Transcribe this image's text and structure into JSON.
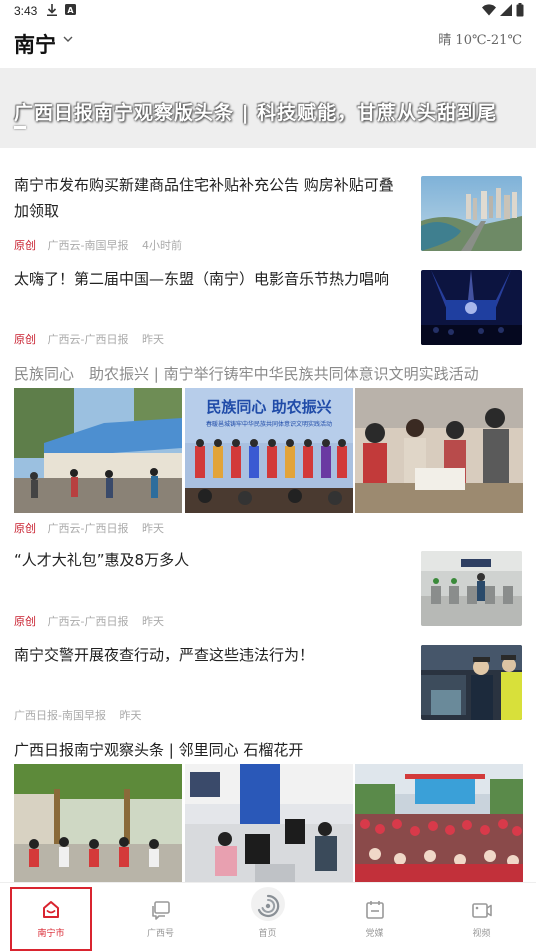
{
  "status_bar": {
    "time": "3:43",
    "icons_left": [
      "download-icon",
      "a-badge-icon"
    ],
    "icons_right": [
      "wifi-icon",
      "signal-icon",
      "battery-icon"
    ]
  },
  "header": {
    "city": "南宁",
    "weather": "晴 10℃-21℃"
  },
  "banner": {
    "text": "广西日报南宁观察版头条 | 科技赋能，甘蔗从头甜到尾"
  },
  "feed": [
    {
      "title_line1": "南宁市发布购买新建商品住宅补贴补充公告 购房补贴可叠",
      "title_line2": "加领取",
      "original": "原创",
      "source": "广西云-南国早报",
      "time": "4小时前",
      "thumb": "city-river-photo"
    },
    {
      "title_line1": "太嗨了！第二届中国—东盟（南宁）电影音乐节热力唱响",
      "original": "原创",
      "source": "广西云-广西日报",
      "time": "昨天",
      "thumb": "concert-stage-photo"
    },
    {
      "group_title": "民族同心　助农振兴 | 南宁举行铸牢中华民族共同体意识文明实践活动",
      "original": "原创",
      "source": "广西云-广西日报",
      "time": "昨天",
      "images": [
        "market-tents-photo",
        "ethnic-performers-photo",
        "crowd-stalls-photo"
      ],
      "image_banner": "民族同心 助农振兴",
      "image_subtitle": "春暖邕城铸牢中华民族共同体意识文明实践活动"
    },
    {
      "title_line1": "“人才大礼包”惠及8万多人",
      "original": "原创",
      "source": "广西云-广西日报",
      "time": "昨天",
      "thumb": "metro-gates-photo"
    },
    {
      "title_line1": "南宁交警开展夜查行动，严查这些违法行为！",
      "source": "广西日报-南国早报",
      "time": "昨天",
      "thumb": "traffic-police-photo"
    },
    {
      "group_title": "广西日报南宁观察头条 | 邻里同心 石榴花开",
      "images": [
        "courtyard-gathering-photo",
        "service-hall-photo",
        "square-dance-photo"
      ]
    }
  ],
  "bottom_nav": [
    {
      "label": "南宁市",
      "icon": "city-home-icon",
      "active": true
    },
    {
      "label": "广西号",
      "icon": "chat-cards-icon",
      "active": false
    },
    {
      "label": "首页",
      "icon": "swirl-logo-icon",
      "active": false
    },
    {
      "label": "党媒",
      "icon": "calendar-icon",
      "active": false
    },
    {
      "label": "视频",
      "icon": "video-icon",
      "active": false
    }
  ],
  "colors": {
    "accent": "#d9242f",
    "meta_grey": "#aaaaaa",
    "banner_bg": "#eeeeee"
  }
}
